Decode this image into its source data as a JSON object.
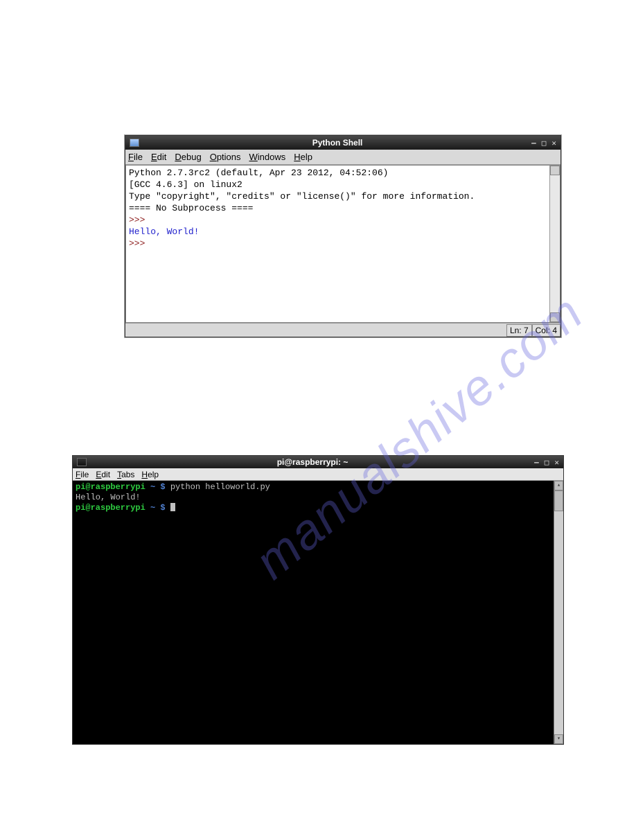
{
  "watermark": "manualshive.com",
  "win1": {
    "title": "Python Shell",
    "menu": {
      "file": "File",
      "edit": "Edit",
      "debug": "Debug",
      "options": "Options",
      "windows": "Windows",
      "help": "Help"
    },
    "lines": {
      "l1": "Python 2.7.3rc2 (default, Apr 23 2012, 04:52:06)",
      "l2": "[GCC 4.6.3] on linux2",
      "l3": "Type \"copyright\", \"credits\" or \"license()\" for more information.",
      "l4": "==== No Subprocess ====",
      "p1": ">>> ",
      "out": "Hello, World!",
      "p2": ">>> "
    },
    "status": {
      "ln": "Ln: 7",
      "col": "Col: 4"
    },
    "controls": {
      "min": "–",
      "max": "□",
      "close": "✕"
    }
  },
  "win2": {
    "title": "pi@raspberrypi: ~",
    "menu": {
      "file": "File",
      "edit": "Edit",
      "tabs": "Tabs",
      "help": "Help"
    },
    "line1": {
      "user": "pi@raspberrypi",
      "tilde": " ~ $ ",
      "cmd": "python helloworld.py"
    },
    "line2": "Hello, World!",
    "line3": {
      "user": "pi@raspberrypi",
      "tilde": " ~ $ "
    },
    "controls": {
      "min": "–",
      "max": "□",
      "close": "✕"
    }
  }
}
